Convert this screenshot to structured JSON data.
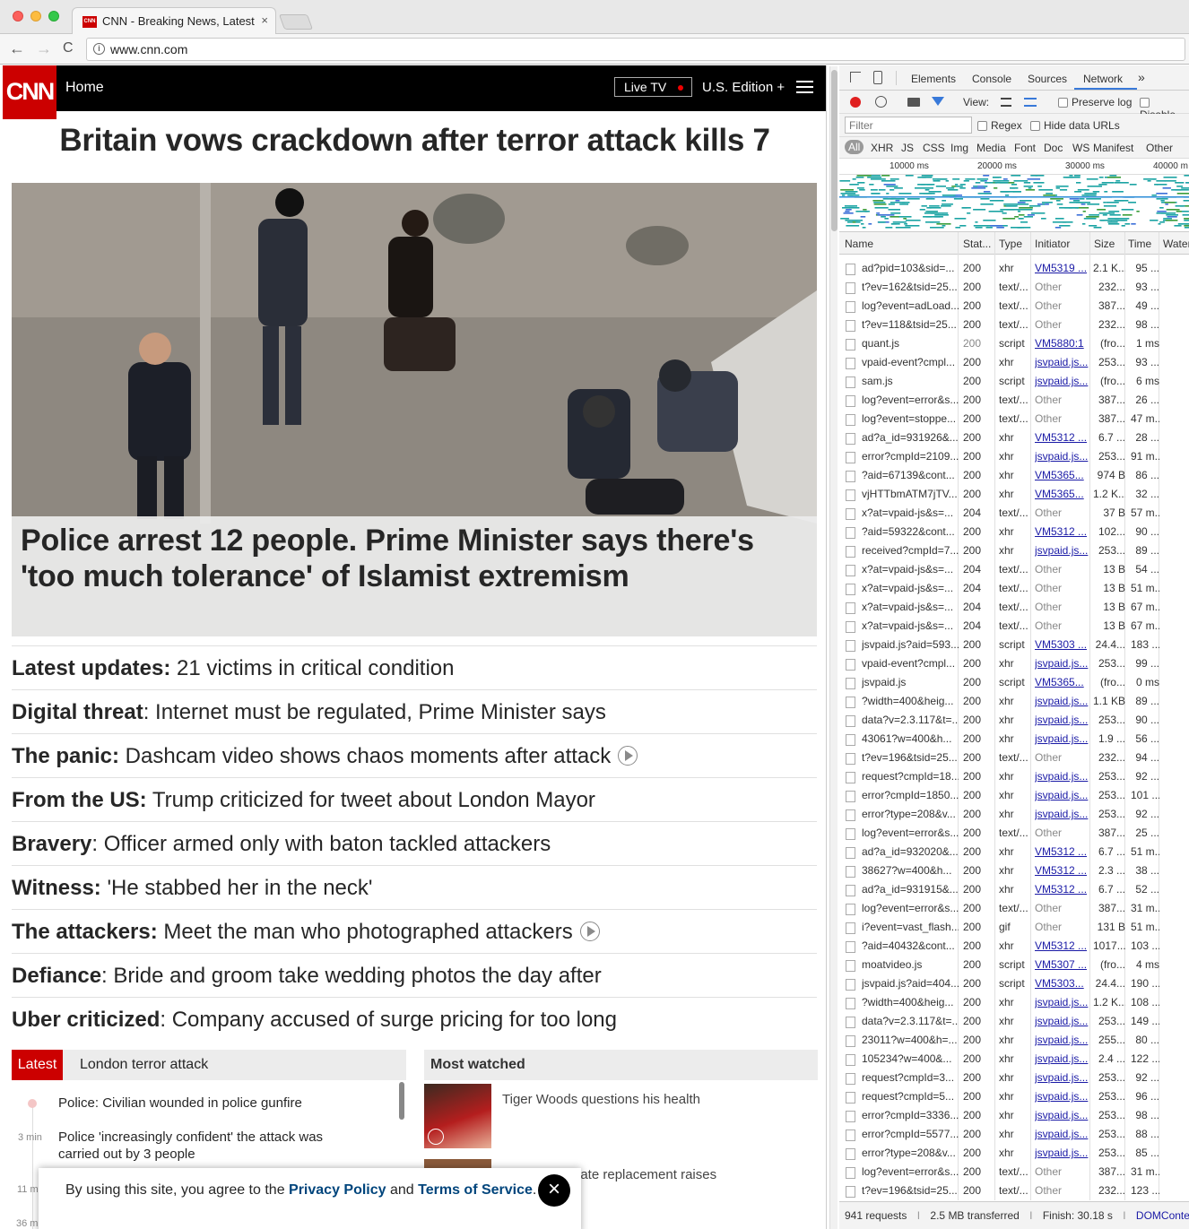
{
  "browser": {
    "tab_title": "CNN - Breaking News, Latest N",
    "tab_favicon": "CNN",
    "close_glyph": "×",
    "url": "www.cnn.com",
    "back": "←",
    "forward": "→",
    "reload": "C",
    "info": "i"
  },
  "cnn": {
    "logo": "CNN",
    "nav_home": "Home",
    "live_tv": "Live TV",
    "edition": "U.S. Edition +",
    "headline": "Britain vows crackdown after terror attack kills 7",
    "hero_caption": "Police arrest 12 people. Prime Minister says there's 'too much tolerance' of Islamist extremism",
    "items": [
      {
        "bold": "Latest updates:",
        "text": " 21 victims in critical condition",
        "video": false
      },
      {
        "bold": "Digital threat",
        "text": ": Internet must be regulated, Prime Minister says",
        "video": false
      },
      {
        "bold": "The panic:",
        "text": " Dashcam video shows chaos moments after attack",
        "video": true
      },
      {
        "bold": "From the US:",
        "text": " Trump criticized for tweet about London Mayor",
        "video": false
      },
      {
        "bold": "Bravery",
        "text": ": Officer armed only with baton tackled attackers",
        "video": false
      },
      {
        "bold": "Witness:",
        "text": " 'He stabbed her in the neck'",
        "video": false
      },
      {
        "bold": "The attackers:",
        "text": " Meet the man who photographed attackers",
        "video": true
      },
      {
        "bold": "Defiance",
        "text": ": Bride and groom take wedding photos the day after",
        "video": false
      },
      {
        "bold": "Uber criticized",
        "text": ": Company accused of surge pricing for too long",
        "video": false
      }
    ],
    "latest_label": "Latest",
    "latest_topic": "London terror attack",
    "timeline": [
      {
        "time": "",
        "text": "Police: Civilian wounded in police gunfire"
      },
      {
        "time": "3 min",
        "text": "Police 'increasingly confident' the attack was carried out by 3 people"
      },
      {
        "time": "11 m",
        "text": ""
      },
      {
        "time": "36 m",
        "text": ""
      }
    ],
    "most_watched_label": "Most watched",
    "watched": [
      {
        "title": "Tiger Woods questions his health"
      },
      {
        "title": "nate replacement raises"
      }
    ],
    "cookie": {
      "pre": "By using this site, you agree to the ",
      "privacy": "Privacy Policy",
      "and": " and ",
      "terms": "Terms of Service",
      "post": ".",
      "close": "×"
    }
  },
  "devtools": {
    "tabs": [
      "Elements",
      "Console",
      "Sources",
      "Network",
      "»"
    ],
    "active_tab": "Network",
    "view_label": "View:",
    "preserve_log": "Preserve log",
    "disable_cache": "Disable",
    "filter_placeholder": "Filter",
    "regex": "Regex",
    "hide_data_urls": "Hide data URLs",
    "types": [
      "All",
      "XHR",
      "JS",
      "CSS",
      "Img",
      "Media",
      "Font",
      "Doc",
      "WS",
      "Manifest",
      "Other"
    ],
    "timeline_ticks": [
      "10000 ms",
      "20000 ms",
      "30000 ms",
      "40000 m"
    ],
    "columns": [
      "Name",
      "Stat...",
      "Type",
      "Initiator",
      "Size",
      "Time",
      "Water"
    ],
    "rows": [
      [
        "ad?pid=103&sid=...",
        "200",
        "xhr",
        "VM5319 ...",
        "2.1 K...",
        "95 ..."
      ],
      [
        "t?ev=162&tsid=25...",
        "200",
        "text/...",
        "Other",
        "232...",
        "93 ..."
      ],
      [
        "log?event=adLoad...",
        "200",
        "text/...",
        "Other",
        "387...",
        "49 ..."
      ],
      [
        "t?ev=118&tsid=25...",
        "200",
        "text/...",
        "Other",
        "232...",
        "98 ..."
      ],
      [
        "quant.js",
        "200",
        "script",
        "VM5880:1",
        "(fro...",
        "1 ms"
      ],
      [
        "vpaid-event?cmpl...",
        "200",
        "xhr",
        "jsvpaid.js...",
        "253...",
        "93 ..."
      ],
      [
        "sam.js",
        "200",
        "script",
        "jsvpaid.js...",
        "(fro...",
        "6 ms"
      ],
      [
        "log?event=error&s...",
        "200",
        "text/...",
        "Other",
        "387...",
        "26 ..."
      ],
      [
        "log?event=stoppe...",
        "200",
        "text/...",
        "Other",
        "387...",
        "47 m..."
      ],
      [
        "ad?a_id=931926&...",
        "200",
        "xhr",
        "VM5312 ...",
        "6.7 ...",
        "28 ..."
      ],
      [
        "error?cmpId=2109...",
        "200",
        "xhr",
        "jsvpaid.js...",
        "253...",
        "91 m..."
      ],
      [
        "?aid=67139&cont...",
        "200",
        "xhr",
        "VM5365...",
        "974 B",
        "86 ..."
      ],
      [
        "vjHTTbmATM7jTV...",
        "200",
        "xhr",
        "VM5365...",
        "1.2 K...",
        "32 ..."
      ],
      [
        "x?at=vpaid-js&s=...",
        "204",
        "text/...",
        "Other",
        "37 B",
        "57 m..."
      ],
      [
        "?aid=59322&cont...",
        "200",
        "xhr",
        "VM5312 ...",
        "102...",
        "90 ..."
      ],
      [
        "received?cmpId=7...",
        "200",
        "xhr",
        "jsvpaid.js...",
        "253...",
        "89 ..."
      ],
      [
        "x?at=vpaid-js&s=...",
        "204",
        "text/...",
        "Other",
        "13 B",
        "54 ..."
      ],
      [
        "x?at=vpaid-js&s=...",
        "204",
        "text/...",
        "Other",
        "13 B",
        "51 m..."
      ],
      [
        "x?at=vpaid-js&s=...",
        "204",
        "text/...",
        "Other",
        "13 B",
        "67 m..."
      ],
      [
        "x?at=vpaid-js&s=...",
        "204",
        "text/...",
        "Other",
        "13 B",
        "67 m..."
      ],
      [
        "jsvpaid.js?aid=593...",
        "200",
        "script",
        "VM5303 ...",
        "24.4...",
        "183 ..."
      ],
      [
        "vpaid-event?cmpl...",
        "200",
        "xhr",
        "jsvpaid.js...",
        "253...",
        "99 ..."
      ],
      [
        "jsvpaid.js",
        "200",
        "script",
        "VM5365...",
        "(fro...",
        "0 ms"
      ],
      [
        "?width=400&heig...",
        "200",
        "xhr",
        "jsvpaid.js...",
        "1.1 KB",
        "89 ..."
      ],
      [
        "data?v=2.3.117&t=...",
        "200",
        "xhr",
        "jsvpaid.js...",
        "253...",
        "90 ..."
      ],
      [
        "43061?w=400&h...",
        "200",
        "xhr",
        "jsvpaid.js...",
        "1.9 ...",
        "56 ..."
      ],
      [
        "t?ev=196&tsid=25...",
        "200",
        "text/...",
        "Other",
        "232...",
        "94 ..."
      ],
      [
        "request?cmpId=18...",
        "200",
        "xhr",
        "jsvpaid.js...",
        "253...",
        "92 ..."
      ],
      [
        "error?cmpId=1850...",
        "200",
        "xhr",
        "jsvpaid.js...",
        "253...",
        "101 ..."
      ],
      [
        "error?type=208&v...",
        "200",
        "xhr",
        "jsvpaid.js...",
        "253...",
        "92 ..."
      ],
      [
        "log?event=error&s...",
        "200",
        "text/...",
        "Other",
        "387...",
        "25 ..."
      ],
      [
        "ad?a_id=932020&...",
        "200",
        "xhr",
        "VM5312 ...",
        "6.7 ...",
        "51 m..."
      ],
      [
        "38627?w=400&h...",
        "200",
        "xhr",
        "VM5312 ...",
        "2.3 ...",
        "38 ..."
      ],
      [
        "ad?a_id=931915&...",
        "200",
        "xhr",
        "VM5312 ...",
        "6.7 ...",
        "52 ..."
      ],
      [
        "log?event=error&s...",
        "200",
        "text/...",
        "Other",
        "387...",
        "31 m..."
      ],
      [
        "i?event=vast_flash...",
        "200",
        "gif",
        "Other",
        "131 B",
        "51 m..."
      ],
      [
        "?aid=40432&cont...",
        "200",
        "xhr",
        "VM5312 ...",
        "1017...",
        "103 ..."
      ],
      [
        "moatvideo.js",
        "200",
        "script",
        "VM5307 ...",
        "(fro...",
        "4 ms"
      ],
      [
        "jsvpaid.js?aid=404...",
        "200",
        "script",
        "VM5303...",
        "24.4...",
        "190 ..."
      ],
      [
        "?width=400&heig...",
        "200",
        "xhr",
        "jsvpaid.js...",
        "1.2 K...",
        "108 ..."
      ],
      [
        "data?v=2.3.117&t=...",
        "200",
        "xhr",
        "jsvpaid.js...",
        "253...",
        "149 ..."
      ],
      [
        "23011?w=400&h=...",
        "200",
        "xhr",
        "jsvpaid.js...",
        "255...",
        "80 ..."
      ],
      [
        "105234?w=400&...",
        "200",
        "xhr",
        "jsvpaid.js...",
        "2.4 ...",
        "122 ..."
      ],
      [
        "request?cmpId=3...",
        "200",
        "xhr",
        "jsvpaid.js...",
        "253...",
        "92 ..."
      ],
      [
        "request?cmpId=5...",
        "200",
        "xhr",
        "jsvpaid.js...",
        "253...",
        "96 ..."
      ],
      [
        "error?cmpId=3336...",
        "200",
        "xhr",
        "jsvpaid.js...",
        "253...",
        "98 ..."
      ],
      [
        "error?cmpId=5577...",
        "200",
        "xhr",
        "jsvpaid.js...",
        "253...",
        "88 ..."
      ],
      [
        "error?type=208&v...",
        "200",
        "xhr",
        "jsvpaid.js...",
        "253...",
        "85 ..."
      ],
      [
        "log?event=error&s...",
        "200",
        "text/...",
        "Other",
        "387...",
        "31 m..."
      ],
      [
        "t?ev=196&tsid=25...",
        "200",
        "text/...",
        "Other",
        "232...",
        "123 ..."
      ]
    ],
    "status": {
      "requests": "941 requests",
      "transferred": "2.5 MB transferred",
      "finish": "Finish: 30.18 s",
      "dcl": "DOMContentLoad",
      "sep": "I"
    }
  },
  "colors": {
    "cnn_red": "#cc0000",
    "link_blue": "#00457c",
    "devtools_link": "#1a1aa6"
  }
}
